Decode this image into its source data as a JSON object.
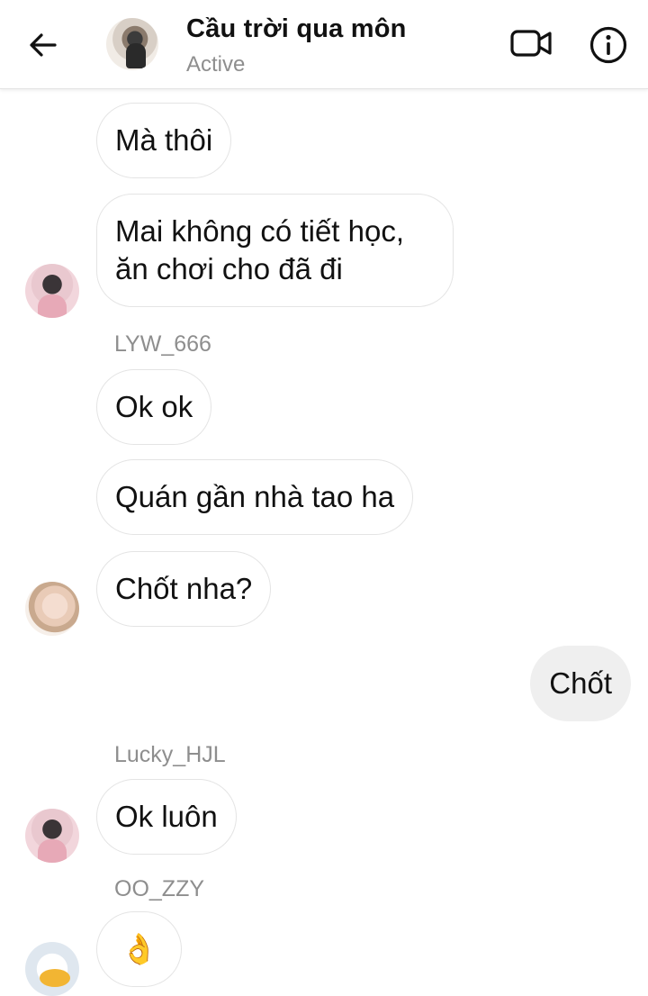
{
  "header": {
    "title": "Cầu trời qua môn",
    "status": "Active",
    "back_icon": "arrow-left-icon",
    "video_icon": "video-camera-icon",
    "info_icon": "info-circle-icon"
  },
  "messages": [
    {
      "text": "Mà thôi"
    },
    {
      "text": "Mai không có tiết học, ăn chơi cho đã đi"
    },
    {
      "sender": "LYW_666"
    },
    {
      "text": "Ok ok"
    },
    {
      "text": "Quán gần nhà tao ha"
    },
    {
      "text": "Chốt nha?"
    },
    {
      "text": "Chốt"
    },
    {
      "sender": "Lucky_HJL"
    },
    {
      "text": "Ok luôn"
    },
    {
      "sender": "OO_ZZY"
    },
    {
      "text": "👌"
    }
  ],
  "colors": {
    "bubble_border": "#e4e4e4",
    "self_bubble": "#efefef",
    "muted_text": "#8e8e8e"
  }
}
